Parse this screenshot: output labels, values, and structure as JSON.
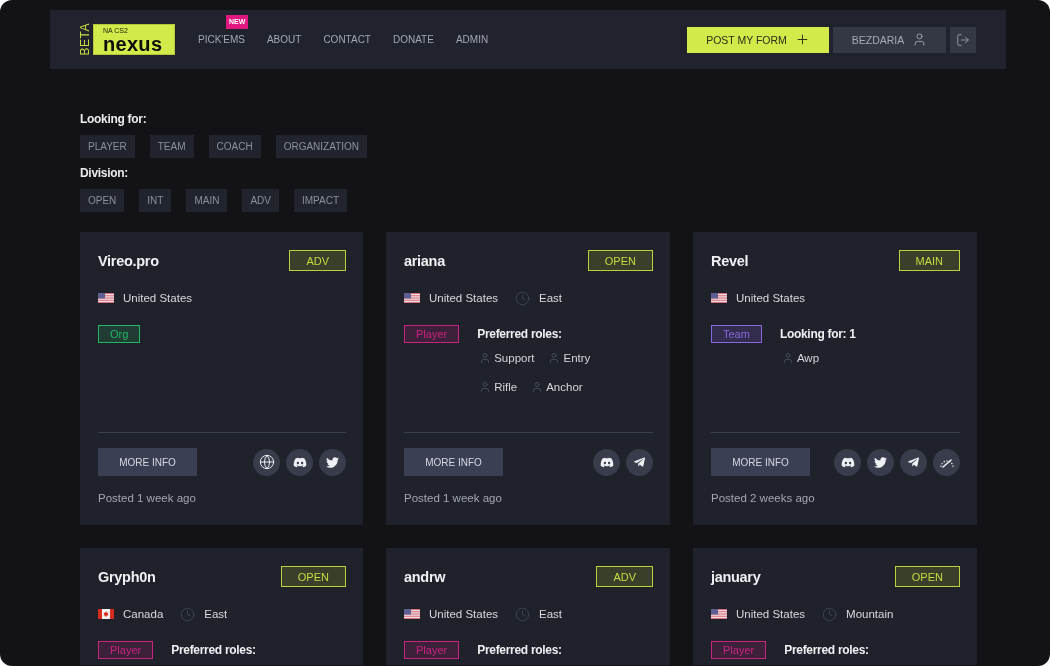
{
  "header": {
    "logo": {
      "tag": "BETA",
      "subtitle": "NA CS2",
      "title": "nexus"
    },
    "nav": [
      {
        "label": "PICK'EMS",
        "badge": "NEW"
      },
      {
        "label": "ABOUT"
      },
      {
        "label": "CONTACT"
      },
      {
        "label": "DONATE"
      },
      {
        "label": "ADMIN"
      }
    ],
    "post_button": "POST MY FORM",
    "user_button": "BEZDARIA"
  },
  "filters": [
    {
      "label": "Looking for:",
      "options": [
        {
          "label": "PLAYER",
          "selected": false
        },
        {
          "label": "TEAM",
          "selected": false
        },
        {
          "label": "COACH",
          "selected": false
        },
        {
          "label": "ORGANIZATION",
          "selected": false
        }
      ]
    },
    {
      "label": "Division:",
      "options": [
        {
          "label": "OPEN",
          "selected": false
        },
        {
          "label": "INT",
          "selected": false
        },
        {
          "label": "MAIN",
          "selected": false
        },
        {
          "label": "ADV",
          "selected": false
        },
        {
          "label": "IMPACT",
          "selected": false
        }
      ]
    }
  ],
  "cards": [
    {
      "name": "Vireo.pro",
      "division": "ADV",
      "country": {
        "name": "United States",
        "kind": "us"
      },
      "type": {
        "label": "Org",
        "color": "#22b863"
      },
      "more_info": "MORE INFO",
      "socials": [
        {
          "kind": "web"
        },
        {
          "kind": "discord"
        },
        {
          "kind": "twitter"
        }
      ],
      "posted": "Posted 1 week ago"
    },
    {
      "name": "ariana",
      "division": "OPEN",
      "country": {
        "name": "United States",
        "kind": "us"
      },
      "region": "East",
      "type": {
        "label": "Player",
        "color": "#c8237f"
      },
      "details": {
        "label": "Preferred roles:",
        "roles": [
          "Support",
          "Entry",
          "Rifle",
          "Anchor"
        ]
      },
      "more_info": "MORE INFO",
      "socials": [
        {
          "kind": "discord"
        },
        {
          "kind": "telegram"
        }
      ],
      "posted": "Posted 1 week ago"
    },
    {
      "name": "Revel",
      "division": "MAIN",
      "country": {
        "name": "United States",
        "kind": "us"
      },
      "type": {
        "label": "Team",
        "color": "#8a66e0"
      },
      "details": {
        "label": "Looking for: 1",
        "roles": [
          "Awp"
        ]
      },
      "more_info": "MORE INFO",
      "socials": [
        {
          "kind": "discord"
        },
        {
          "kind": "twitter"
        },
        {
          "kind": "telegram"
        },
        {
          "kind": "gauge"
        }
      ],
      "posted": "Posted 2 weeks ago"
    },
    {
      "name": "Gryph0n",
      "division": "OPEN",
      "country": {
        "name": "Canada",
        "kind": "ca"
      },
      "region": "East",
      "type": {
        "label": "Player",
        "color": "#c8237f"
      },
      "details": {
        "label": "Preferred roles:"
      }
    },
    {
      "name": "andrw",
      "division": "ADV",
      "country": {
        "name": "United States",
        "kind": "us"
      },
      "region": "East",
      "type": {
        "label": "Player",
        "color": "#c8237f"
      },
      "details": {
        "label": "Preferred roles:"
      }
    },
    {
      "name": "january",
      "division": "OPEN",
      "country": {
        "name": "United States",
        "kind": "us"
      },
      "region": "Mountain",
      "type": {
        "label": "Player",
        "color": "#c8237f"
      },
      "details": {
        "label": "Preferred roles:"
      }
    }
  ]
}
